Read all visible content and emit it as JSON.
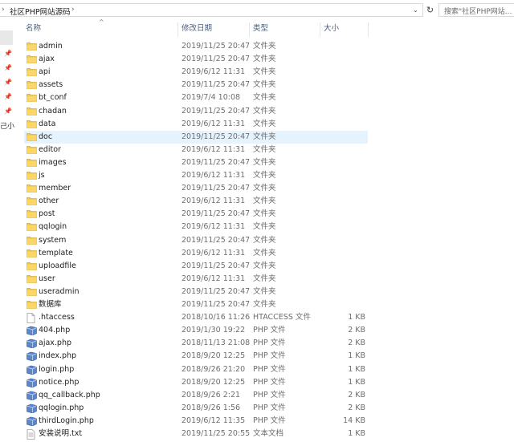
{
  "address_bar": {
    "separator": "›",
    "path": "社区PHP网站源码",
    "trailing_separator": "›",
    "dropdown": "⌄",
    "refresh": "↻"
  },
  "search": {
    "placeholder": "搜索\"社区PHP网站..."
  },
  "nav": {
    "partial_label": "己小"
  },
  "columns": {
    "name": "名称",
    "date": "修改日期",
    "type": "类型",
    "size": "大小",
    "sort_indicator": "^"
  },
  "files": [
    {
      "name": "admin",
      "date": "2019/11/25 20:47",
      "type": "文件夹",
      "size": "",
      "icon": "folder-icon"
    },
    {
      "name": "ajax",
      "date": "2019/11/25 20:47",
      "type": "文件夹",
      "size": "",
      "icon": "folder-icon"
    },
    {
      "name": "api",
      "date": "2019/6/12 11:31",
      "type": "文件夹",
      "size": "",
      "icon": "folder-icon"
    },
    {
      "name": "assets",
      "date": "2019/11/25 20:47",
      "type": "文件夹",
      "size": "",
      "icon": "folder-icon"
    },
    {
      "name": "bt_conf",
      "date": "2019/7/4 10:08",
      "type": "文件夹",
      "size": "",
      "icon": "folder-icon"
    },
    {
      "name": "chadan",
      "date": "2019/11/25 20:47",
      "type": "文件夹",
      "size": "",
      "icon": "folder-icon"
    },
    {
      "name": "data",
      "date": "2019/6/12 11:31",
      "type": "文件夹",
      "size": "",
      "icon": "folder-icon"
    },
    {
      "name": "doc",
      "date": "2019/11/25 20:47",
      "type": "文件夹",
      "size": "",
      "icon": "folder-icon",
      "highlighted": true
    },
    {
      "name": "editor",
      "date": "2019/6/12 11:31",
      "type": "文件夹",
      "size": "",
      "icon": "folder-icon"
    },
    {
      "name": "images",
      "date": "2019/11/25 20:47",
      "type": "文件夹",
      "size": "",
      "icon": "folder-icon"
    },
    {
      "name": "js",
      "date": "2019/6/12 11:31",
      "type": "文件夹",
      "size": "",
      "icon": "folder-icon"
    },
    {
      "name": "member",
      "date": "2019/11/25 20:47",
      "type": "文件夹",
      "size": "",
      "icon": "folder-icon"
    },
    {
      "name": "other",
      "date": "2019/6/12 11:31",
      "type": "文件夹",
      "size": "",
      "icon": "folder-icon"
    },
    {
      "name": "post",
      "date": "2019/11/25 20:47",
      "type": "文件夹",
      "size": "",
      "icon": "folder-icon"
    },
    {
      "name": "qqlogin",
      "date": "2019/6/12 11:31",
      "type": "文件夹",
      "size": "",
      "icon": "folder-icon"
    },
    {
      "name": "system",
      "date": "2019/11/25 20:47",
      "type": "文件夹",
      "size": "",
      "icon": "folder-icon"
    },
    {
      "name": "template",
      "date": "2019/6/12 11:31",
      "type": "文件夹",
      "size": "",
      "icon": "folder-icon"
    },
    {
      "name": "uploadfile",
      "date": "2019/11/25 20:47",
      "type": "文件夹",
      "size": "",
      "icon": "folder-icon"
    },
    {
      "name": "user",
      "date": "2019/6/12 11:31",
      "type": "文件夹",
      "size": "",
      "icon": "folder-icon"
    },
    {
      "name": "useradmin",
      "date": "2019/11/25 20:47",
      "type": "文件夹",
      "size": "",
      "icon": "folder-icon"
    },
    {
      "name": "数据库",
      "date": "2019/11/25 20:47",
      "type": "文件夹",
      "size": "",
      "icon": "folder-icon"
    },
    {
      "name": ".htaccess",
      "date": "2018/10/16 11:26",
      "type": "HTACCESS 文件",
      "size": "1 KB",
      "icon": "file-icon"
    },
    {
      "name": "404.php",
      "date": "2019/1/30 19:22",
      "type": "PHP 文件",
      "size": "2 KB",
      "icon": "php-file-icon"
    },
    {
      "name": "ajax.php",
      "date": "2018/11/13 21:08",
      "type": "PHP 文件",
      "size": "2 KB",
      "icon": "php-file-icon"
    },
    {
      "name": "index.php",
      "date": "2018/9/20 12:25",
      "type": "PHP 文件",
      "size": "1 KB",
      "icon": "php-file-icon"
    },
    {
      "name": "login.php",
      "date": "2018/9/26 21:20",
      "type": "PHP 文件",
      "size": "1 KB",
      "icon": "php-file-icon"
    },
    {
      "name": "notice.php",
      "date": "2018/9/20 12:25",
      "type": "PHP 文件",
      "size": "1 KB",
      "icon": "php-file-icon"
    },
    {
      "name": "qq_callback.php",
      "date": "2018/9/26 2:21",
      "type": "PHP 文件",
      "size": "2 KB",
      "icon": "php-file-icon"
    },
    {
      "name": "qqlogin.php",
      "date": "2018/9/26 1:56",
      "type": "PHP 文件",
      "size": "2 KB",
      "icon": "php-file-icon"
    },
    {
      "name": "thirdLogin.php",
      "date": "2019/6/12 11:35",
      "type": "PHP 文件",
      "size": "14 KB",
      "icon": "php-file-icon"
    },
    {
      "name": "安装说明.txt",
      "date": "2019/11/25 20:55",
      "type": "文本文档",
      "size": "1 KB",
      "icon": "text-file-icon"
    }
  ]
}
